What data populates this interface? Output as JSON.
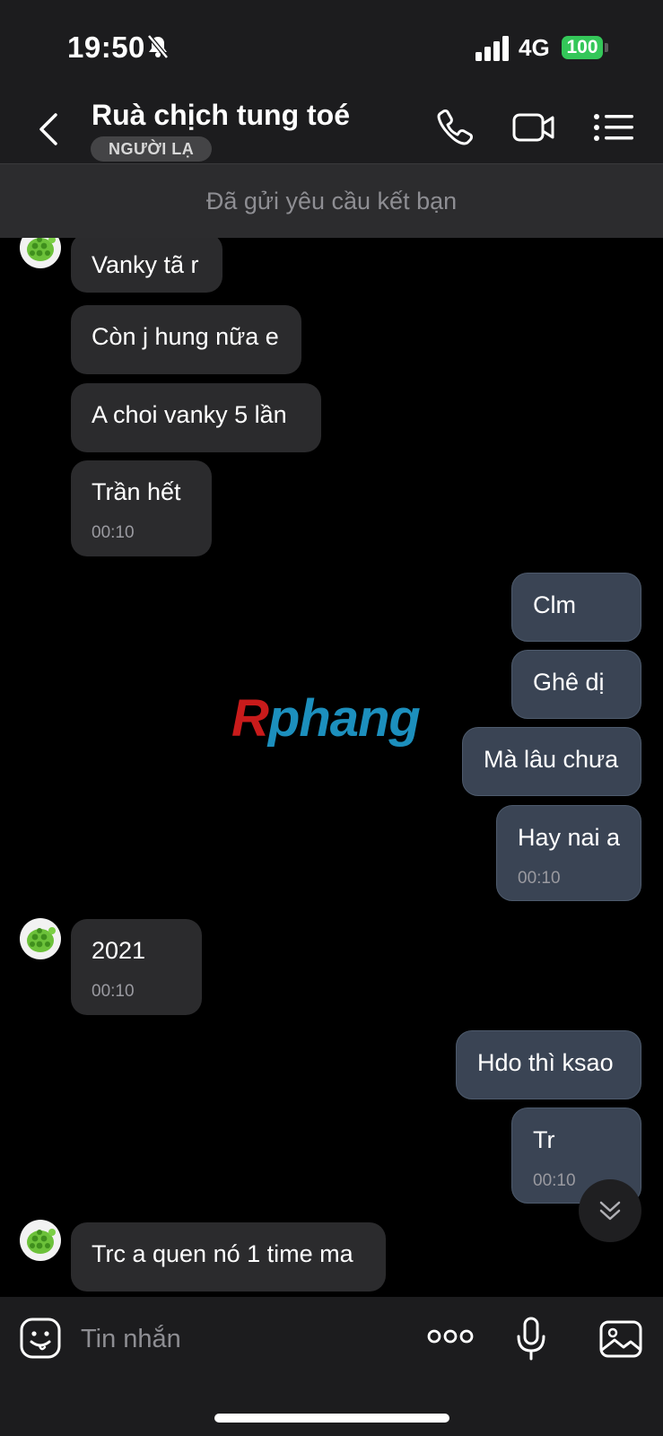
{
  "status": {
    "time": "19:50",
    "network": "4G",
    "battery": "100",
    "bell_icon": "bell-slash-icon"
  },
  "header": {
    "title": "Ruà chịch tung toé",
    "tag": "NGƯỜI LẠ",
    "icons": [
      "back-arrow-icon",
      "phone-icon",
      "video-camera-icon",
      "menu-list-icon"
    ]
  },
  "banner": "Đã gửi yêu cầu kết bạn",
  "messages": [
    {
      "dir": "in",
      "text": "Vanky tã r"
    },
    {
      "dir": "in",
      "text": "Còn j hung nữa e"
    },
    {
      "dir": "in",
      "text": "A choi vanky 5 lần"
    },
    {
      "dir": "in",
      "text": "Trần hết",
      "time": "00:10"
    },
    {
      "dir": "out",
      "text": "Clm"
    },
    {
      "dir": "out",
      "text": "Ghê dị"
    },
    {
      "dir": "out",
      "text": "Mà lâu chưa"
    },
    {
      "dir": "out",
      "text": "Hay nai a",
      "time": "00:10"
    },
    {
      "dir": "in",
      "text": "2021",
      "time": "00:10"
    },
    {
      "dir": "out",
      "text": "Hdo thì ksao"
    },
    {
      "dir": "out",
      "text": "Tr",
      "time": "00:10"
    },
    {
      "dir": "in",
      "text": "Trc a quen nó 1 time ma"
    }
  ],
  "watermark": {
    "r": "R",
    "rest": "phang"
  },
  "input": {
    "placeholder": "Tin nhắn"
  },
  "colors": {
    "outgoing": "#3a4454",
    "incoming": "#2b2b2d",
    "battery": "#34c759"
  }
}
